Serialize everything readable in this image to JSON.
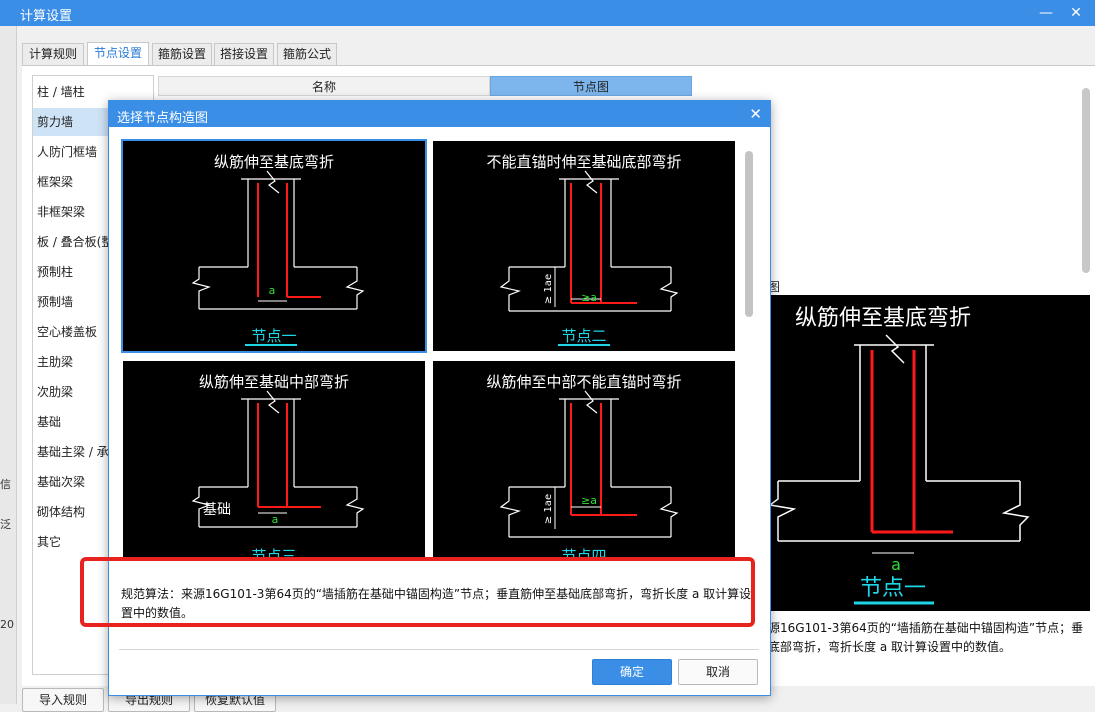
{
  "window": {
    "title": "计算设置",
    "minimize": "—",
    "maximize": "□",
    "close": "✕"
  },
  "background_left": [
    "罡",
    "信",
    "泛",
    "20"
  ],
  "tabs": [
    "计算规则",
    "节点设置",
    "箍筋设置",
    "搭接设置",
    "箍筋公式"
  ],
  "active_tab": "节点设置",
  "categories": [
    "柱 / 墙柱",
    "剪力墙",
    "人防门框墙",
    "框架梁",
    "非框架梁",
    "板 / 叠合板(整",
    "预制柱",
    "预制墙",
    "空心楼盖板",
    "主肋梁",
    "次肋梁",
    "基础",
    "基础主梁 / 承",
    "基础次梁",
    "砌体结构",
    "其它"
  ],
  "selected_category": "剪力墙",
  "table": {
    "col_name": "名称",
    "col_node": "节点图"
  },
  "preview": {
    "label": "图",
    "title": "纵筋伸至基底弯折",
    "dim": "a",
    "node_label": "节点一",
    "desc_line1": "源16G101-3第64页的“墙插筋在基础中锚固构造”节点；垂",
    "desc_line2": "底部弯折，弯折长度 a 取计算设置中的数值。"
  },
  "bottom_buttons": [
    "导入规则",
    "导出规则",
    "恢复默认值"
  ],
  "dialog": {
    "title": "选择节点构造图",
    "close": "✕",
    "nodes": [
      {
        "title": "纵筋伸至基底弯折",
        "label": "节点一",
        "dim": "a"
      },
      {
        "title": "不能直锚时伸至基础底部弯折",
        "label": "节点二",
        "dim": "≥a",
        "vdim": "≥ 1ae"
      },
      {
        "title": "纵筋伸至基础中部弯折",
        "label": "节点三",
        "dim": "a",
        "base": "基础"
      },
      {
        "title": "纵筋伸至中部不能直锚时弯折",
        "label": "节点四",
        "dim": "≥a",
        "vdim": "≥ 1ae"
      }
    ],
    "description": "规范算法：来源16G101-3第64页的“墙插筋在基础中锚固构造”节点；垂直筋伸至基础底部弯折，弯折长度 a 取计算设置中的数值。",
    "ok": "确定",
    "cancel": "取消"
  },
  "colors": {
    "accent": "#3a8ee6",
    "rebar": "#ff1a1a",
    "label_cyan": "#1ed6e6",
    "highlight_box": "#e8231f"
  }
}
